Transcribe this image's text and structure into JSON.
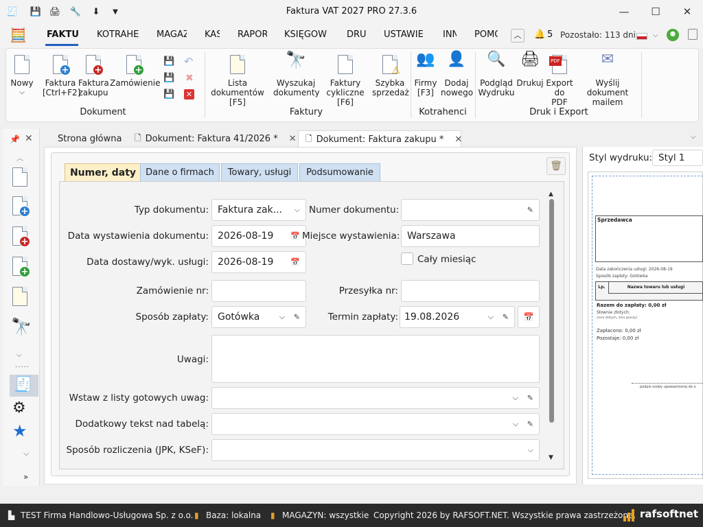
{
  "window": {
    "title": "Faktura VAT 2027 PRO 27.3.6"
  },
  "menu": {
    "items": [
      "FAKTU",
      "KOTRAHE",
      "MAGAZ",
      "KAS",
      "RAPOR",
      "KSIĘGOW",
      "DRU",
      "USTAWIE",
      "INN",
      "POMO"
    ],
    "notifications": "5",
    "remaining": "Pozostało: 113 dni"
  },
  "ribbon": {
    "nowy": "Nowy",
    "faktura": [
      "Faktura",
      "[Ctrl+F2]"
    ],
    "faktura_zakupu": [
      "Faktura",
      "zakupu"
    ],
    "zamowienie": "Zamówienie",
    "lista": [
      "Lista",
      "dokumentów [F5]"
    ],
    "wyszukaj": [
      "Wyszukaj",
      "dokumenty"
    ],
    "cykliczne": [
      "Faktury",
      "cykliczne [F6]"
    ],
    "szybka": [
      "Szybka",
      "sprzedaż"
    ],
    "firmy": [
      "Firmy",
      "[F3]"
    ],
    "dodaj": [
      "Dodaj",
      "nowego"
    ],
    "podglad": [
      "Podgląd",
      "Wydruku"
    ],
    "drukuj": "Drukuj",
    "pdf": [
      "Export",
      "do PDF"
    ],
    "mail": [
      "Wyślij dokument",
      "mailem"
    ],
    "groups": {
      "dokument": "Dokument",
      "faktury": "Faktury",
      "kontrahenci": "Kotrahenci",
      "druk": "Druk i Export"
    }
  },
  "tabs": {
    "home": "Strona główna",
    "doc1": "Dokument: Faktura 41/2026 *",
    "doc2": "Dokument: Faktura zakupu *"
  },
  "form_tabs": [
    "Numer, daty",
    "Dane o firmach",
    "Towary, usługi",
    "Podsumowanie"
  ],
  "form": {
    "typ_label": "Typ dokumentu:",
    "typ_value": "Faktura zak...",
    "numer_label": "Numer dokumentu:",
    "numer_value": "",
    "data_wyst_label": "Data wystawienia dokumentu:",
    "data_wyst_value": "2026-08-19",
    "miejsce_label": "Miejsce wystawienia:",
    "miejsce_value": "Warszawa",
    "data_dost_label": "Data dostawy/wyk. usługi:",
    "data_dost_value": "2026-08-19",
    "caly_label": "Cały miesiąc",
    "zam_label": "Zamówienie nr:",
    "zam_value": "",
    "przes_label": "Przesyłka nr:",
    "przes_value": "",
    "sposob_label": "Sposób zapłaty:",
    "sposob_value": "Gotówka",
    "termin_label": "Termin zapłaty:",
    "termin_value": "19.08.2026",
    "uwagi_label": "Uwagi:",
    "wstaw_label": "Wstaw z listy gotowych uwag:",
    "dodatkowy_label": "Dodatkowy tekst nad tabelą:",
    "rozliczenie_label": "Sposób rozliczenia (JPK, KSeF):"
  },
  "preview": {
    "style_label": "Styl wydruku:",
    "style_value": "Styl 1",
    "sprzedawca": "Sprzedawca",
    "data_zak": "Data zakończenia usługi: 2026-08-19",
    "sposob": "Sposób zapłaty: Gotówka",
    "lp": "Lp.",
    "nazwa": "Nazwa towaru lub usługi",
    "razem": "Razem do zapłaty: 0,00 zł",
    "slownie": "Słownie złotych:",
    "slownie2": "(zero złotych, zero groszy)",
    "zaplacono": "Zapłacono: 0,00 zł",
    "pozostaje": "Pozostaje: 0,00 zł",
    "podpis": "podpis osoby upoważnionej do o"
  },
  "status": {
    "firma": "TEST Firma Handlowo-Usługowa Sp. z o.o.",
    "baza": "Baza: lokalna",
    "magazyn": "MAGAZYN: wszystkie",
    "copyright": "Copyright 2026 by RAFSOFT.NET. Wszystkie prawa zastrzeżone.",
    "logo": "rafsoftnet"
  },
  "colors": {
    "accent": "#1f5fbf",
    "tab_active": "#fdf0c8",
    "tab_inactive": "#cfe0f3"
  }
}
